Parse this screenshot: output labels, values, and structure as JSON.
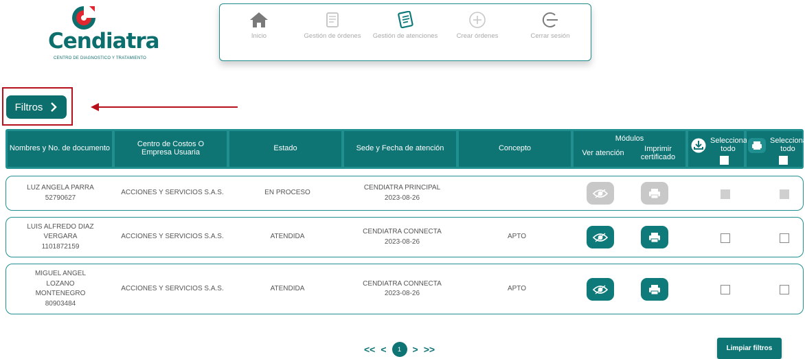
{
  "brand": {
    "name": "Cendiatra",
    "tagline": "CENTRO DE DIAGNOSTICO Y TRATAMIENTO",
    "color": "#0d6e6e",
    "accent": "#e0262e"
  },
  "nav": {
    "items": [
      {
        "label": "Inicio",
        "icon": "home-icon"
      },
      {
        "label": "Gestión de órdenes",
        "icon": "orders-icon"
      },
      {
        "label": "Gestión de atenciones",
        "icon": "attention-list-icon"
      },
      {
        "label": "Crear órdenes",
        "icon": "plus-circle-icon"
      },
      {
        "label": "Cerrar sesión",
        "icon": "logout-icon"
      }
    ]
  },
  "filters": {
    "label": "Filtros",
    "clear_label": "Limpiar filtros"
  },
  "table": {
    "headers": {
      "name": "Nombres y No. de documento",
      "cost_center": "Centro de Costos O Empresa Usuaria",
      "status": "Estado",
      "site_date": "Sede y Fecha de atención",
      "concept": "Concepto",
      "modules": "Módulos",
      "view": "Ver atención",
      "print": "Imprimir certificado",
      "select_all_download": "Selecciona todo",
      "select_all_print": "Selecciona todo"
    },
    "rows": [
      {
        "name_lines": [
          "LUZ ANGELA PARRA",
          "52790627"
        ],
        "cost_center": "ACCIONES Y SERVICIOS S.A.S.",
        "status": "EN PROCESO",
        "site": "CENDIATRA PRINCIPAL",
        "date": "2023-08-26",
        "concept": "",
        "enabled": false
      },
      {
        "name_lines": [
          "LUIS ALFREDO DIAZ",
          "VERGARA",
          "1101872159"
        ],
        "cost_center": "ACCIONES Y SERVICIOS S.A.S.",
        "status": "ATENDIDA",
        "site": "CENDIATRA CONNECTA",
        "date": "2023-08-26",
        "concept": "APTO",
        "enabled": true
      },
      {
        "name_lines": [
          "MIGUEL ANGEL",
          "LOZANO",
          "MONTENEGRO",
          "80903484"
        ],
        "cost_center": "ACCIONES Y SERVICIOS S.A.S.",
        "status": "ATENDIDA",
        "site": "CENDIATRA CONNECTA",
        "date": "2023-08-26",
        "concept": "APTO",
        "enabled": true
      }
    ]
  },
  "pagination": {
    "first": "<<",
    "prev": "<",
    "current": "1",
    "next": ">",
    "last": ">>"
  }
}
